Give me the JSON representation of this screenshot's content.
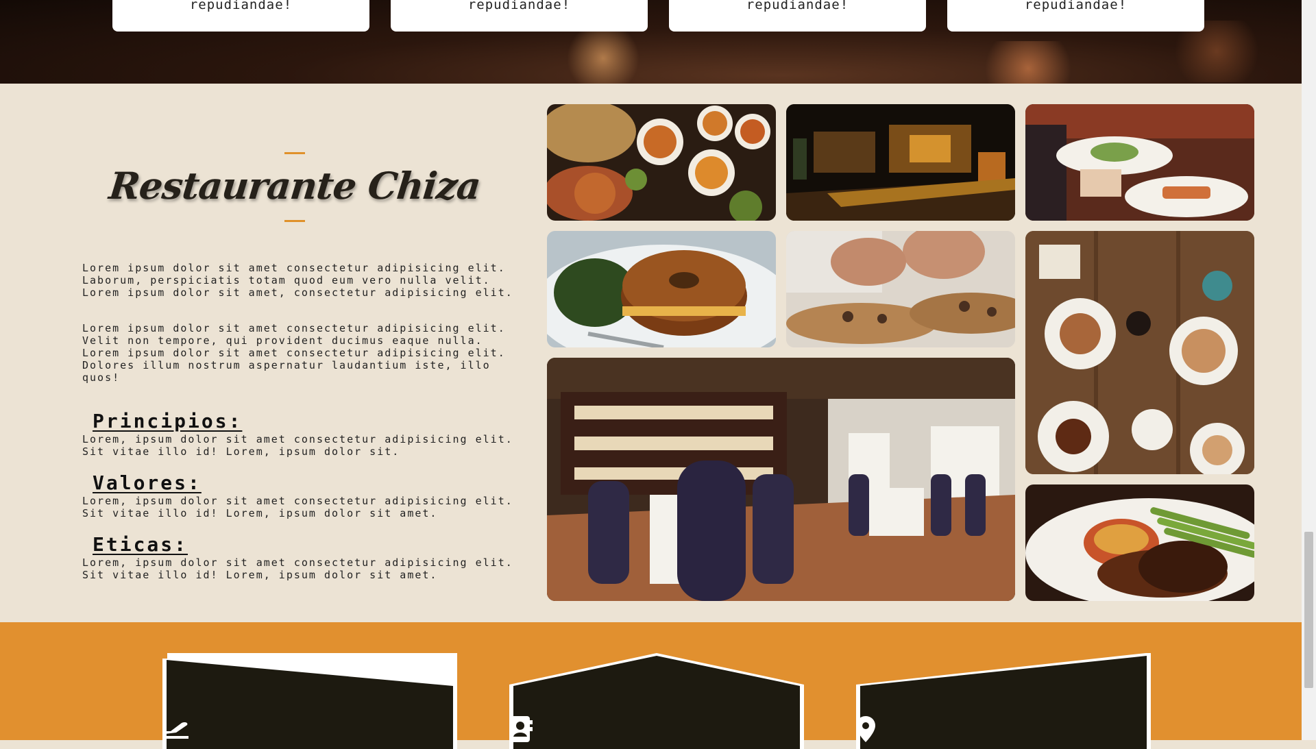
{
  "top_cards": [
    {
      "text": "repudiandae!"
    },
    {
      "text": "repudiandae!"
    },
    {
      "text": "repudiandae!"
    },
    {
      "text": "repudiandae!"
    }
  ],
  "about": {
    "title": "Restaurante Chiza",
    "paragraph1": "Lorem ipsum dolor sit amet consectetur adipisicing elit.\nLaborum, perspiciatis totam quod eum vero nulla velit.\nLorem ipsum dolor sit amet, consectetur adipisicing elit.",
    "paragraph2": "Lorem ipsum dolor sit amet consectetur adipisicing elit.\nVelit non tempore, qui provident ducimus eaque nulla.\nLorem ipsum dolor sit amet consectetur adipisicing elit.\nDolores illum nostrum aspernatur laudantium iste, illo\nquos!",
    "sections": [
      {
        "heading": "Principios:",
        "text": "Lorem, ipsum dolor sit amet consectetur adipisicing elit.\nSit vitae illo id! Lorem, ipsum dolor sit."
      },
      {
        "heading": "Valores:",
        "text": "Lorem, ipsum dolor sit amet consectetur adipisicing elit.\nSit vitae illo id! Lorem, ipsum dolor sit amet."
      },
      {
        "heading": "Eticas:",
        "text": "Lorem, ipsum dolor sit amet consectetur adipisicing elit.\nSit vitae illo id! Lorem, ipsum dolor sit amet."
      }
    ]
  },
  "gallery": [
    {
      "subject": "indian-food-bowls"
    },
    {
      "subject": "restaurant-bar-interior"
    },
    {
      "subject": "waiter-serving-plates"
    },
    {
      "subject": "bagel-sandwich"
    },
    {
      "subject": "chef-plating"
    },
    {
      "subject": "table-top-breakfast"
    },
    {
      "subject": "dining-room-interior"
    },
    {
      "subject": "steak-asparagus"
    }
  ],
  "feature_icons": [
    "plane-departure-icon",
    "address-book-icon",
    "map-pin-icon"
  ],
  "colors": {
    "accent": "#e1902f",
    "background": "#ece3d4",
    "panel": "#1e1a12"
  }
}
